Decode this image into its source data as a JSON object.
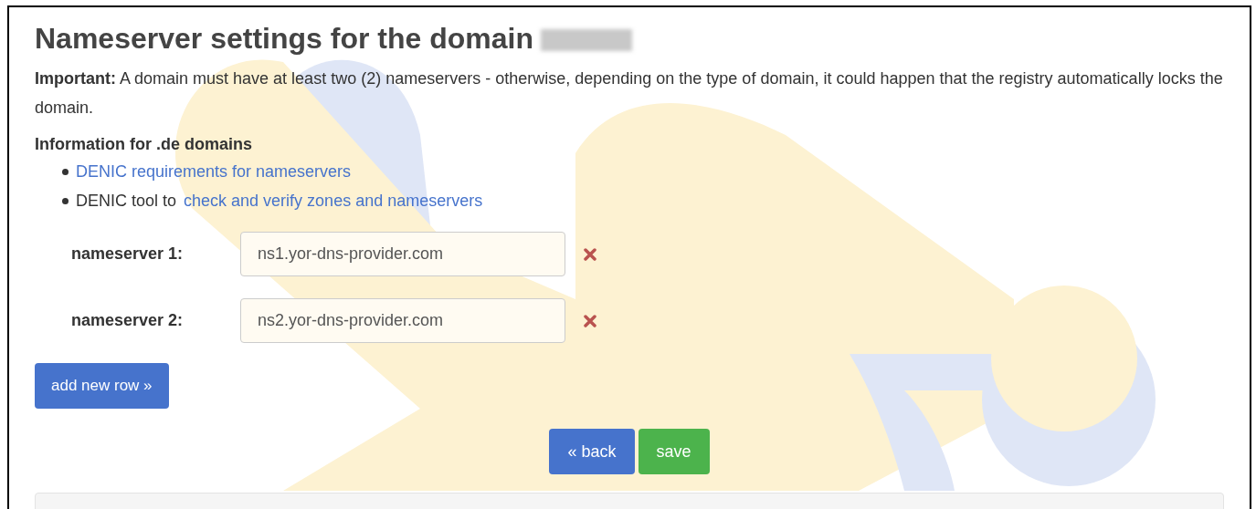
{
  "title": "Nameserver settings for the domain",
  "notice": "**Important:** A domain must have at least two (2) nameservers - otherwise, depending on the type of domain, it could happen that the registry automatically locks the domain.",
  "info": {
    "heading": "Information for .de domains",
    "items": [
      {
        "link": "DENIC requirements for nameservers"
      },
      {
        "text": "DENIC tool to",
        "link": "check and verify zones and nameservers"
      }
    ]
  },
  "nameservers": [
    {
      "label": "nameserver 1:",
      "value": "ns1.yor-dns-provider.com"
    },
    {
      "label": "nameserver 2:",
      "value": "ns2.yor-dns-provider.com"
    }
  ],
  "add_button": "add new row »",
  "buttons": [
    {
      "kind": "back",
      "label": "« back"
    },
    {
      "kind": "save",
      "label": "save"
    }
  ]
}
